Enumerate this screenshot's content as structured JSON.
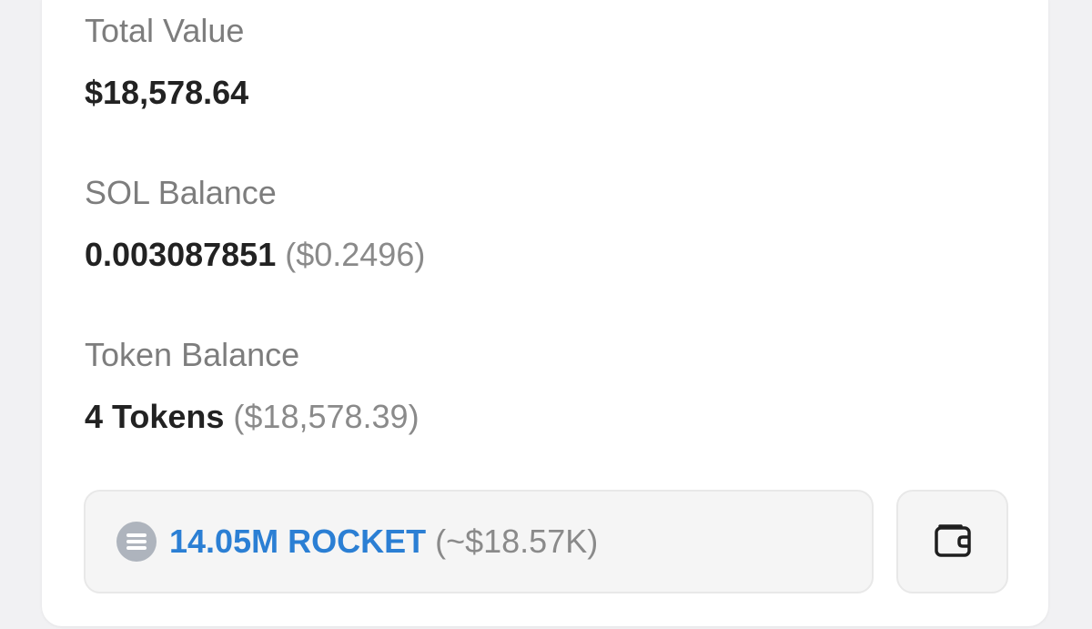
{
  "total_value": {
    "label": "Total Value",
    "value": "$18,578.64"
  },
  "sol_balance": {
    "label": "SOL Balance",
    "amount": "0.003087851",
    "usd": "($0.2496)"
  },
  "token_balance": {
    "label": "Token Balance",
    "count": "4 Tokens",
    "usd": "($18,578.39)"
  },
  "top_token": {
    "amount_name": "14.05M ROCKET",
    "approx_usd": "(~$18.57K)",
    "icon": "coin-icon"
  },
  "wallet_button": {
    "icon": "wallet-icon"
  },
  "colors": {
    "accent": "#2b7fd4",
    "label_gray": "#7d7d7d",
    "value_dark": "#222222",
    "coin_gray": "#aeb4bd"
  }
}
